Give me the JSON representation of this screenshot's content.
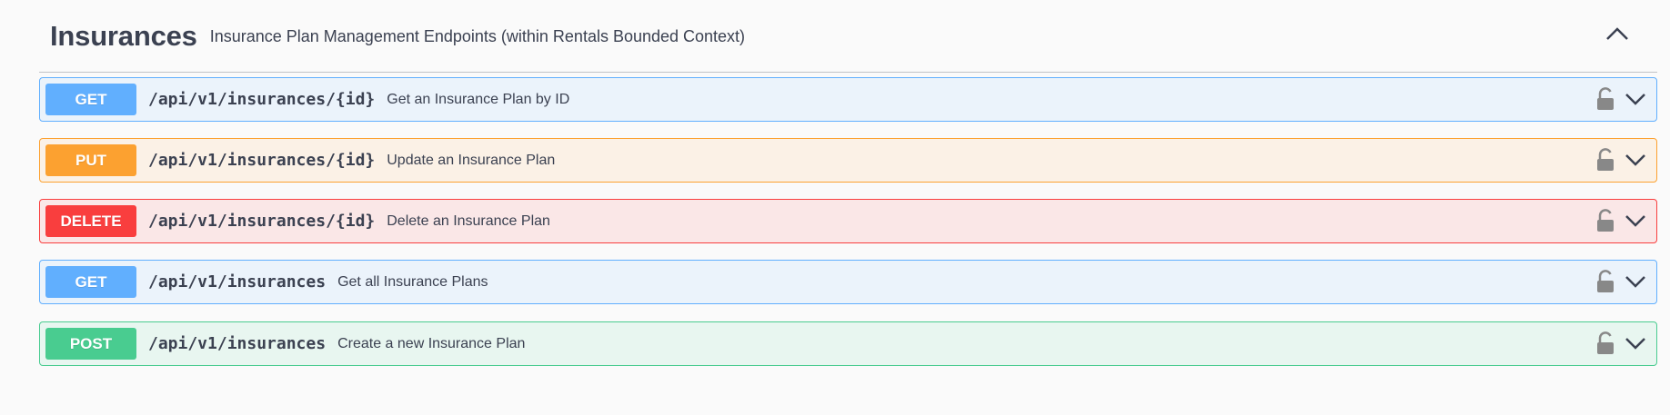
{
  "tag": {
    "title": "Insurances",
    "description": "Insurance Plan Management Endpoints (within Rentals Bounded Context)"
  },
  "operations": [
    {
      "method": "GET",
      "path": "/api/v1/insurances/{id}",
      "summary": "Get an Insurance Plan by ID",
      "color": "#61affe"
    },
    {
      "method": "PUT",
      "path": "/api/v1/insurances/{id}",
      "summary": "Update an Insurance Plan",
      "color": "#fca130"
    },
    {
      "method": "DELETE",
      "path": "/api/v1/insurances/{id}",
      "summary": "Delete an Insurance Plan",
      "color": "#f93e3e"
    },
    {
      "method": "GET",
      "path": "/api/v1/insurances",
      "summary": "Get all Insurance Plans",
      "color": "#61affe"
    },
    {
      "method": "POST",
      "path": "/api/v1/insurances",
      "summary": "Create a new Insurance Plan",
      "color": "#49cc90"
    }
  ],
  "icons": {
    "collapse": "chevron-up-icon",
    "lock": "lock-icon",
    "expand": "chevron-down-icon"
  }
}
